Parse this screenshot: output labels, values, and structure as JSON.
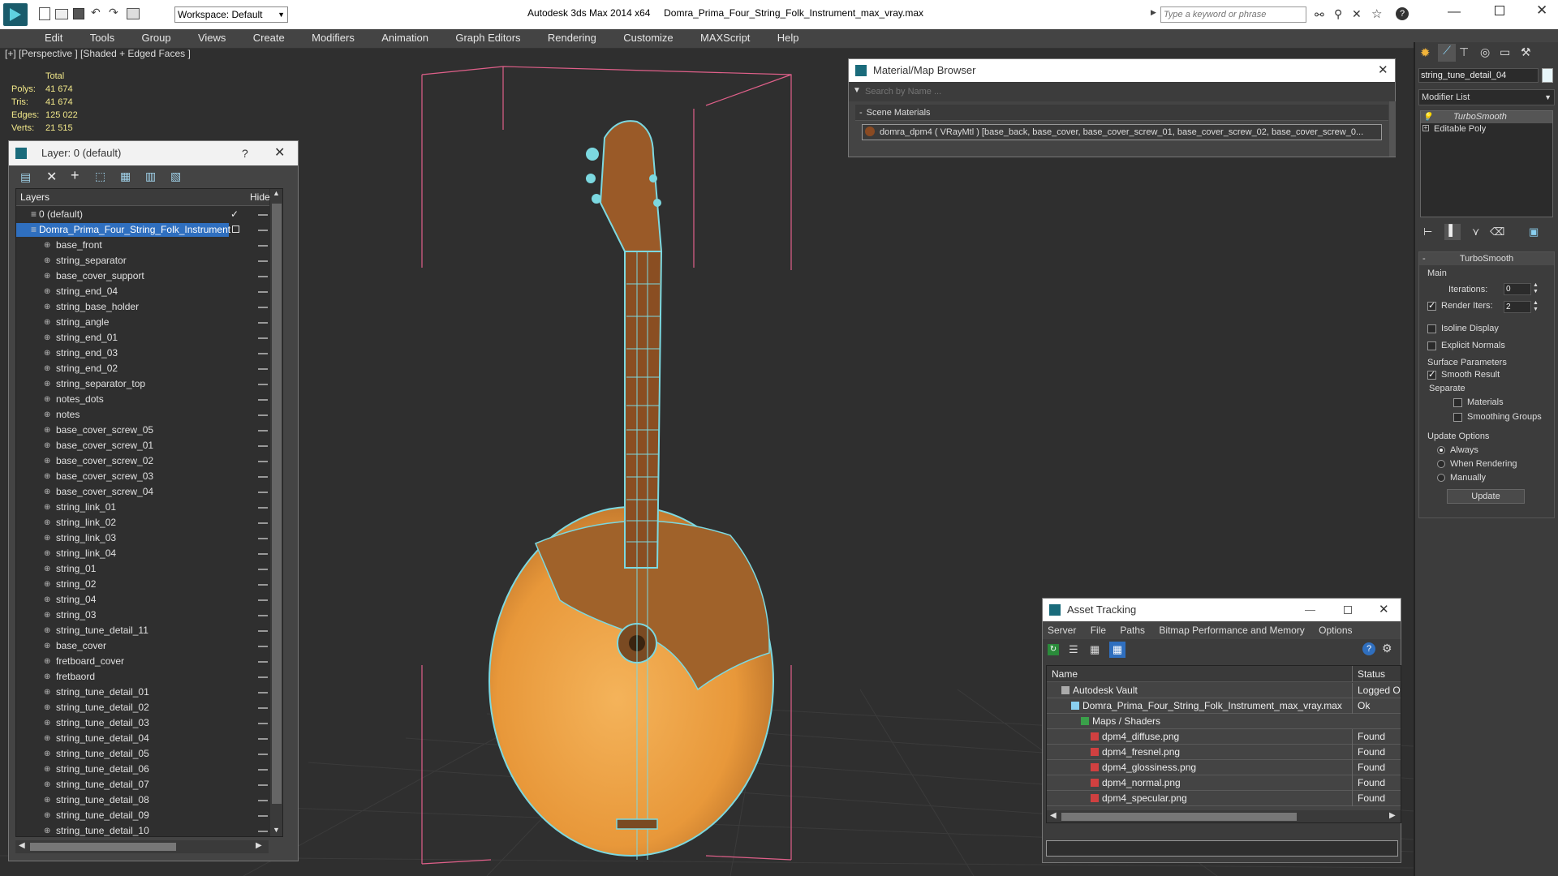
{
  "app": {
    "title_product": "Autodesk 3ds Max  2014 x64",
    "title_file": "Domra_Prima_Four_String_Folk_Instrument_max_vray.max",
    "workspace": "Workspace: Default",
    "search_placeholder": "Type a keyword or phrase"
  },
  "menu": [
    "Edit",
    "Tools",
    "Group",
    "Views",
    "Create",
    "Modifiers",
    "Animation",
    "Graph Editors",
    "Rendering",
    "Customize",
    "MAXScript",
    "Help"
  ],
  "viewport": {
    "label": "[+] [Perspective ] [Shaded + Edged Faces ]",
    "stats": {
      "header": "Total",
      "rows": [
        {
          "label": "Polys:",
          "value": "41 674"
        },
        {
          "label": "Tris:",
          "value": "41 674"
        },
        {
          "label": "Edges:",
          "value": "125 022"
        },
        {
          "label": "Verts:",
          "value": "21 515"
        }
      ]
    }
  },
  "layer_dialog": {
    "title": "Layer: 0 (default)",
    "help": "?",
    "col_layers": "Layers",
    "col_hide": "Hide",
    "default_layer": "0 (default)",
    "selected_layer": "Domra_Prima_Four_String_Folk_Instrument",
    "objects": [
      "base_front",
      "string_separator",
      "base_cover_support",
      "string_end_04",
      "string_base_holder",
      "string_angle",
      "string_end_01",
      "string_end_03",
      "string_end_02",
      "string_separator_top",
      "notes_dots",
      "notes",
      "base_cover_screw_05",
      "base_cover_screw_01",
      "base_cover_screw_02",
      "base_cover_screw_03",
      "base_cover_screw_04",
      "string_link_01",
      "string_link_02",
      "string_link_03",
      "string_link_04",
      "string_01",
      "string_02",
      "string_04",
      "string_03",
      "string_tune_detail_11",
      "base_cover",
      "fretboard_cover",
      "fretbaord",
      "string_tune_detail_01",
      "string_tune_detail_02",
      "string_tune_detail_03",
      "string_tune_detail_04",
      "string_tune_detail_05",
      "string_tune_detail_06",
      "string_tune_detail_07",
      "string_tune_detail_08",
      "string_tune_detail_09",
      "string_tune_detail_10"
    ]
  },
  "material_browser": {
    "title": "Material/Map Browser",
    "search_placeholder": "Search by Name ...",
    "section": "Scene Materials",
    "material": "domra_dpm4  ( VRayMtl ) [base_back, base_cover, base_cover_screw_01, base_cover_screw_02, base_cover_screw_0..."
  },
  "asset_tracking": {
    "title": "Asset Tracking",
    "menu": [
      "Server",
      "File",
      "Paths",
      "Bitmap Performance and Memory",
      "Options"
    ],
    "col_name": "Name",
    "col_status": "Status",
    "rows": [
      {
        "name": "Autodesk Vault",
        "status": "Logged Ou",
        "indent": 1
      },
      {
        "name": "Domra_Prima_Four_String_Folk_Instrument_max_vray.max",
        "status": "Ok",
        "indent": 2
      },
      {
        "name": "Maps / Shaders",
        "status": "",
        "indent": 3
      },
      {
        "name": "dpm4_diffuse.png",
        "status": "Found",
        "indent": 4
      },
      {
        "name": "dpm4_fresnel.png",
        "status": "Found",
        "indent": 4
      },
      {
        "name": "dpm4_glossiness.png",
        "status": "Found",
        "indent": 4
      },
      {
        "name": "dpm4_normal.png",
        "status": "Found",
        "indent": 4
      },
      {
        "name": "dpm4_specular.png",
        "status": "Found",
        "indent": 4
      }
    ]
  },
  "command_panel": {
    "object_name": "string_tune_detail_04",
    "modifier_list": "Modifier List",
    "stack": [
      "TurboSmooth",
      "Editable Poly"
    ],
    "rollout_title": "TurboSmooth",
    "main_label": "Main",
    "iterations_label": "Iterations:",
    "iterations_value": "0",
    "render_iters_label": "Render Iters:",
    "render_iters_value": "2",
    "isoline_label": "Isoline Display",
    "explicit_normals_label": "Explicit Normals",
    "surface_params_label": "Surface Parameters",
    "smooth_result_label": "Smooth Result",
    "separate_label": "Separate",
    "materials_label": "Materials",
    "smoothing_groups_label": "Smoothing Groups",
    "update_options_label": "Update Options",
    "always_label": "Always",
    "when_rendering_label": "When Rendering",
    "manually_label": "Manually",
    "update_button": "Update"
  }
}
